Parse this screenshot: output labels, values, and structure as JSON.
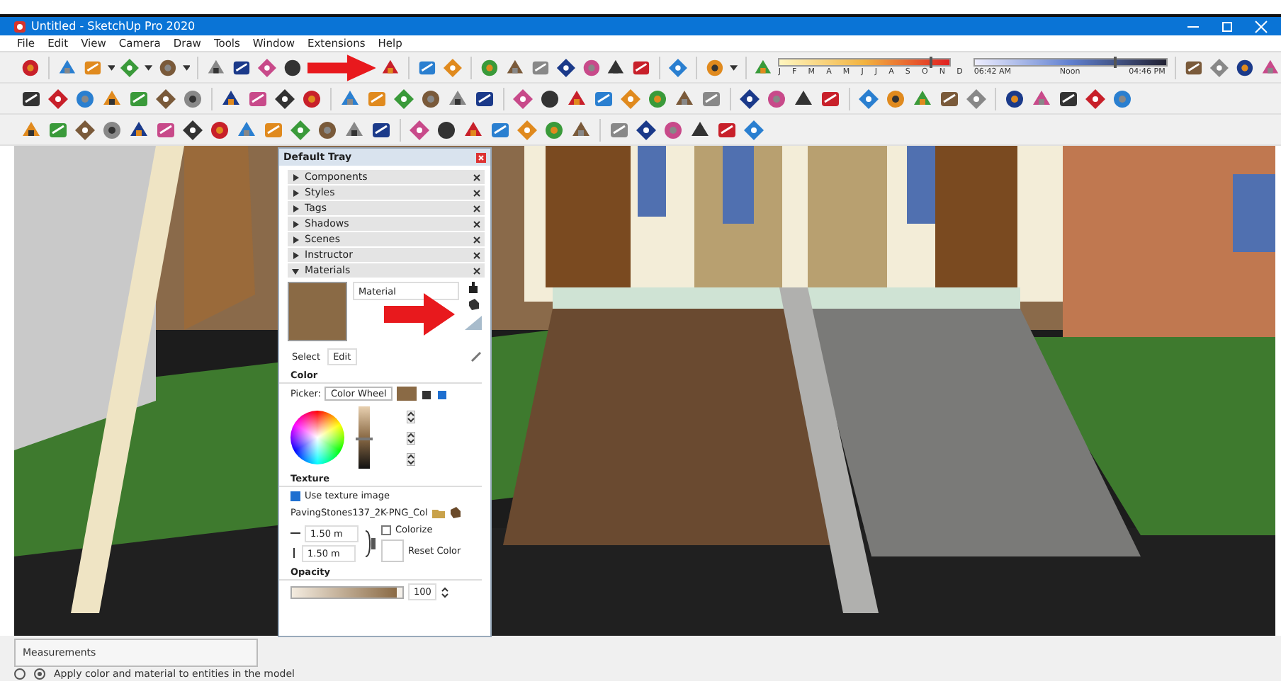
{
  "window": {
    "title": "Untitled - SketchUp Pro 2020"
  },
  "menu": [
    "File",
    "Edit",
    "View",
    "Camera",
    "Draw",
    "Tools",
    "Window",
    "Extensions",
    "Help"
  ],
  "shadow_settings": {
    "months": [
      "J",
      "F",
      "M",
      "A",
      "M",
      "J",
      "J",
      "A",
      "S",
      "O",
      "N",
      "D"
    ],
    "month_slider": {
      "level": 0.88
    },
    "time_start": "06:42 AM",
    "time_mid": "Noon",
    "time_end": "04:46 PM",
    "time_slider": {
      "level": 0.72
    }
  },
  "tray": {
    "title": "Default Tray",
    "panels": [
      {
        "label": "Components",
        "expanded": false
      },
      {
        "label": "Styles",
        "expanded": false
      },
      {
        "label": "Tags",
        "expanded": false
      },
      {
        "label": "Shadows",
        "expanded": false
      },
      {
        "label": "Scenes",
        "expanded": false
      },
      {
        "label": "Instructor",
        "expanded": false
      },
      {
        "label": "Materials",
        "expanded": true
      }
    ],
    "materials": {
      "name": "Material",
      "tabs": [
        {
          "label": "Select",
          "selected": false
        },
        {
          "label": "Edit",
          "selected": true
        }
      ],
      "color_heading": "Color",
      "picker_label": "Picker:",
      "picker": "Color Wheel",
      "value_slider": {
        "level": 0.5
      },
      "texture_heading": "Texture",
      "use_texture": {
        "label": "Use texture image",
        "checked": true
      },
      "texture_file": "PavingStones137_2K-PNG_Col",
      "width": "1.50 m",
      "height": "1.50 m",
      "colorize": {
        "label": "Colorize",
        "checked": false
      },
      "reset_label": "Reset Color",
      "opacity_heading": "Opacity",
      "opacity": {
        "level": 0.95
      },
      "opacity_value": "100"
    }
  },
  "measurements": {
    "label": "Measurements"
  },
  "status": "Apply color and material to entities in the model"
}
